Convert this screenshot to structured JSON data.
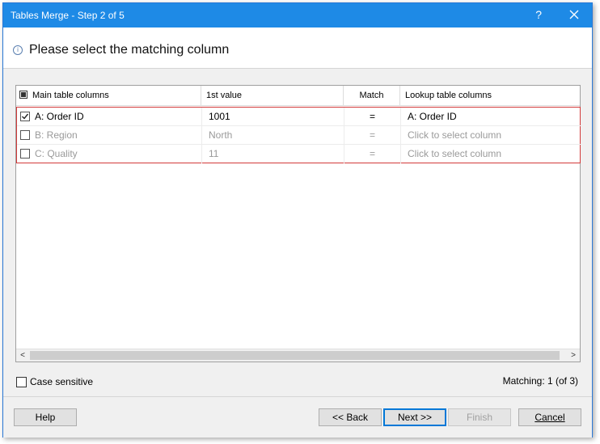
{
  "window": {
    "title": "Tables Merge - Step 2 of 5",
    "help_glyph": "?",
    "close_icon": "close-icon"
  },
  "header": {
    "title": "Please select the matching column",
    "icon": "info-icon"
  },
  "table": {
    "columns": {
      "main": "Main table columns",
      "first_value": "1st value",
      "match": "Match",
      "lookup": "Lookup table columns"
    },
    "rows": [
      {
        "checked": true,
        "main": "A: Order ID",
        "first_value": "1001",
        "match": "=",
        "lookup": "A: Order ID"
      },
      {
        "checked": false,
        "main": "B: Region",
        "first_value": "North",
        "match": "=",
        "lookup": "Click to select column"
      },
      {
        "checked": false,
        "main": "C: Quality",
        "first_value": "11",
        "match": "=",
        "lookup": "Click to select column"
      }
    ],
    "scroll_left": "<",
    "scroll_right": ">"
  },
  "options": {
    "case_sensitive_label": "Case sensitive",
    "case_sensitive_checked": false,
    "matching_text": "Matching: 1 (of 3)"
  },
  "buttons": {
    "help": "Help",
    "back": "<< Back",
    "next": "Next >>",
    "finish": "Finish",
    "cancel": "Cancel"
  },
  "colors": {
    "titlebar": "#1e8ae6",
    "highlight_border": "#d23a3a",
    "default_button_border": "#0078d7"
  }
}
